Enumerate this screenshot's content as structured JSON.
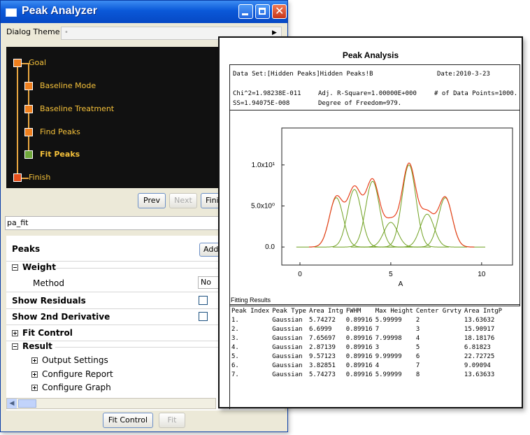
{
  "window": {
    "title": "Peak Analyzer"
  },
  "theme": {
    "label": "Dialog Theme"
  },
  "goal_tree": [
    {
      "label": "Goal",
      "color": "orange",
      "bold": false
    },
    {
      "label": "Baseline Mode",
      "color": "orange",
      "bold": false
    },
    {
      "label": "Baseline Treatment",
      "color": "orange",
      "bold": false
    },
    {
      "label": "Find Peaks",
      "color": "orange",
      "bold": false
    },
    {
      "label": "Fit Peaks",
      "color": "green",
      "bold": true
    },
    {
      "label": "Finish",
      "color": "red",
      "bold": false
    }
  ],
  "nav": {
    "prev": "Prev",
    "next": "Next",
    "finish": "Finish"
  },
  "page_name": "pa_fit",
  "props": {
    "peaks": "Peaks",
    "add": "Add",
    "weight": "Weight",
    "method": "Method",
    "method_value": "No Weighting",
    "show_residuals": "Show Residuals",
    "show_2nd_derivative": "Show 2nd Derivative",
    "fit_control": "Fit Control",
    "result": "Result",
    "output_settings": "Output Settings",
    "configure_report": "Configure Report",
    "configure_graph": "Configure Graph"
  },
  "bottom_buttons": {
    "fit_control": "Fit Control",
    "fit": "Fit"
  },
  "colors": {
    "title_bar": "#0a58d8",
    "tree_bg": "#111111",
    "tree_text": "#f5c13a",
    "cumulative": "#e8401c",
    "peak": "#6fa020"
  },
  "report": {
    "title": "Peak Analysis",
    "dataset": "Data Set:[Hidden Peaks]Hidden Peaks!B",
    "date": "Date:2010-3-23",
    "chi2": "Chi^2=1.98238E-011",
    "adj_r": "Adj. R-Square=1.00000E+000",
    "points": "# of Data Points=1000.",
    "ss": "SS=1.94075E-008",
    "dof": "Degree of Freedom=979.",
    "fitting_results_title": "Fitting Results",
    "table": {
      "headers": [
        "Peak Index",
        "Peak Type",
        "Area Intg",
        "FWHM",
        "Max Height",
        "Center Grvty",
        "Area IntgP"
      ],
      "rows": [
        [
          "1.",
          "Gaussian",
          "5.74272",
          "0.89916",
          "5.99999",
          "2",
          "13.63632"
        ],
        [
          "2.",
          "Gaussian",
          "6.6999",
          "0.89916",
          "7",
          "3",
          "15.90917"
        ],
        [
          "3.",
          "Gaussian",
          "7.65697",
          "0.89916",
          "7.99998",
          "4",
          "18.18176"
        ],
        [
          "4.",
          "Gaussian",
          "2.87139",
          "0.89916",
          "3",
          "5",
          "6.81823"
        ],
        [
          "5.",
          "Gaussian",
          "9.57123",
          "0.89916",
          "9.99999",
          "6",
          "22.72725"
        ],
        [
          "6.",
          "Gaussian",
          "3.82851",
          "0.89916",
          "4",
          "7",
          "9.09094"
        ],
        [
          "7.",
          "Gaussian",
          "5.74273",
          "0.89916",
          "5.99999",
          "8",
          "13.63633"
        ]
      ]
    }
  },
  "chart_data": {
    "type": "line",
    "xlabel": "A",
    "ylabel": "",
    "xlim": [
      -1,
      11.7
    ],
    "ylim": [
      -2.2,
      14.5
    ],
    "xticks": [
      0,
      5,
      10
    ],
    "xtick_labels": [
      "0",
      "5",
      "10"
    ],
    "yticks": [
      0,
      5,
      10
    ],
    "ytick_labels": [
      "0.0",
      "5.0x10⁰",
      "1.0x10¹"
    ],
    "x_range": [
      0.5,
      9.6
    ],
    "fwhm": 0.89916,
    "peaks": [
      {
        "center": 2,
        "height": 5.99999
      },
      {
        "center": 3,
        "height": 7
      },
      {
        "center": 4,
        "height": 7.99998
      },
      {
        "center": 5,
        "height": 3
      },
      {
        "center": 6,
        "height": 9.99999
      },
      {
        "center": 7,
        "height": 4
      },
      {
        "center": 8,
        "height": 5.99999
      }
    ],
    "series": [
      {
        "type": "cumulative",
        "color": "#e8401c"
      },
      {
        "type": "individual-peaks",
        "color": "#6fa020"
      }
    ],
    "grid": false,
    "legend": "none"
  }
}
